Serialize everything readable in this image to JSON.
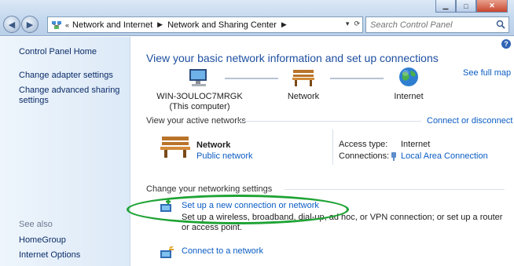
{
  "window": {
    "minimize": "▁",
    "maximize": "□",
    "close": "✕"
  },
  "address": {
    "overflow": "«",
    "crumbs": [
      "Network and Internet",
      "Network and Sharing Center"
    ],
    "dropdown": "▾",
    "refresh": "⟳"
  },
  "search": {
    "placeholder": "Search Control Panel"
  },
  "sidebar": {
    "home": "Control Panel Home",
    "adapter": "Change adapter settings",
    "advanced_1": "Change advanced sharing",
    "advanced_2": "settings",
    "see_also": "See also",
    "homegroup": "HomeGroup",
    "internet_options": "Internet Options"
  },
  "main": {
    "heading": "View your basic network information and set up connections",
    "full_map": "See full map",
    "computer_name": "WIN-3OULOC7MRGK",
    "computer_sub": "(This computer)",
    "network_label": "Network",
    "internet_label": "Internet",
    "active_networks": "View your active networks",
    "connect_disconnect": "Connect or disconnect",
    "network_name": "Network",
    "network_type": "Public network",
    "access_type_label": "Access type:",
    "access_type_value": "Internet",
    "connections_label": "Connections:",
    "connections_value": "Local Area Connection",
    "change_settings": "Change your networking settings",
    "setup_link": "Set up a new connection or network",
    "setup_desc": "Set up a wireless, broadband, dial-up, ad hoc, or VPN connection; or set up a router or access point.",
    "connect_link": "Connect to a network"
  },
  "colors": {
    "highlight_ellipse": "#1ea334",
    "link": "#0b5cc3",
    "heading": "#1e4fa0"
  },
  "icons": [
    "back-arrow-icon",
    "forward-arrow-icon",
    "network-center-icon",
    "search-icon",
    "computer-icon",
    "bench-icon",
    "globe-icon",
    "help-icon",
    "connection-plug-icon",
    "new-connection-icon",
    "connect-network-icon"
  ]
}
